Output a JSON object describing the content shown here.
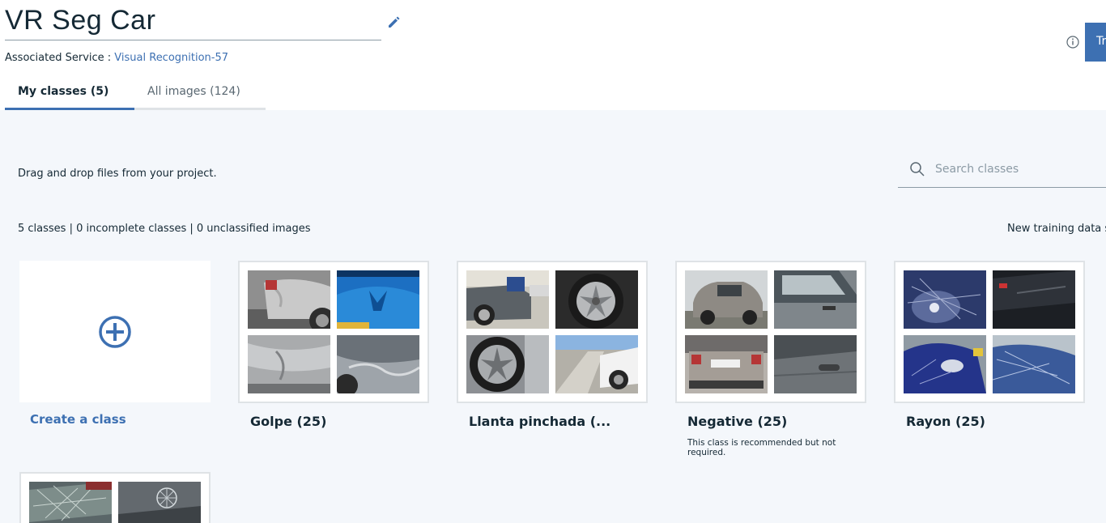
{
  "project": {
    "title": "VR Seg Car",
    "service_label": "Associated Service :",
    "service_link": "Visual Recognition-57",
    "train_button": "Tr"
  },
  "tabs": [
    {
      "label": "My classes (5)",
      "active": true
    },
    {
      "label": "All images (124)",
      "active": false
    }
  ],
  "content": {
    "hint": "Drag and drop files from your project.",
    "search_placeholder": "Search classes",
    "stats": "5 classes | 0 incomplete classes | 0 unclassified images",
    "new_training": "New training data s",
    "create_label": "Create a class"
  },
  "classes": [
    {
      "name": "Golpe (25)",
      "note": ""
    },
    {
      "name": "Llanta pinchada (...",
      "note": ""
    },
    {
      "name": "Negative (25)",
      "note": "This class is recommended but not required."
    },
    {
      "name": "Rayon (25)",
      "note": ""
    }
  ],
  "colors": {
    "accent": "#3d70b2",
    "background": "#f4f7fb",
    "text": "#152935"
  },
  "icons": [
    "edit-icon",
    "info-icon",
    "search-icon",
    "add-circle-icon"
  ]
}
